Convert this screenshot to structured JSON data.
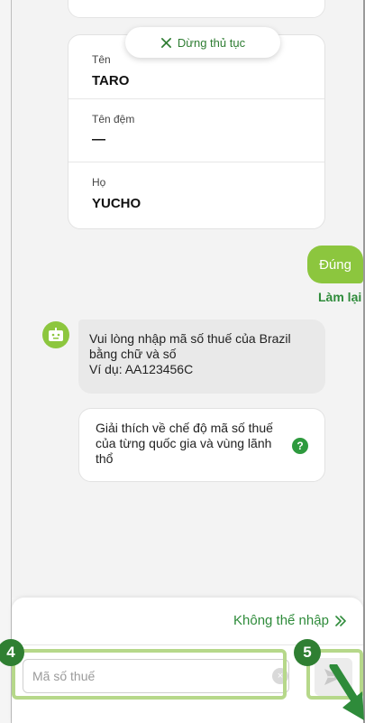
{
  "header": {
    "stop_label": "Dừng thủ tục",
    "stop_icon": "close-icon"
  },
  "name_card": {
    "rows": [
      {
        "label": "Tên",
        "value": "TARO"
      },
      {
        "label": "Tên đệm",
        "value": "—"
      },
      {
        "label": "Họ",
        "value": "YUCHO"
      }
    ]
  },
  "user_answer": "Đúng",
  "redo_label": "Làm lại",
  "bot": {
    "avatar_icon": "bot-icon",
    "message_line1": "Vui lòng nhập mã số thuế của Brazil",
    "message_line2": "bằng chữ và số",
    "message_line3": "Ví dụ: AA123456C"
  },
  "info_card": {
    "text": "Giải thích về chế độ mã số thuế của từng quốc gia và vùng lãnh thổ",
    "help_glyph": "?"
  },
  "input_panel": {
    "cannot_enter_label": "Không thể nhập",
    "cannot_enter_icon": "double-chevron-right-icon",
    "placeholder": "Mã số thuế",
    "value": "",
    "clear_glyph": "×",
    "send_icon": "send-icon"
  },
  "annotations": {
    "badge_input": "4",
    "badge_send": "5"
  },
  "colors": {
    "accent_green": "#8cc63e",
    "dark_green": "#2e8b3a",
    "badge_green": "#2f7f32",
    "highlight": "#b6d88a"
  }
}
